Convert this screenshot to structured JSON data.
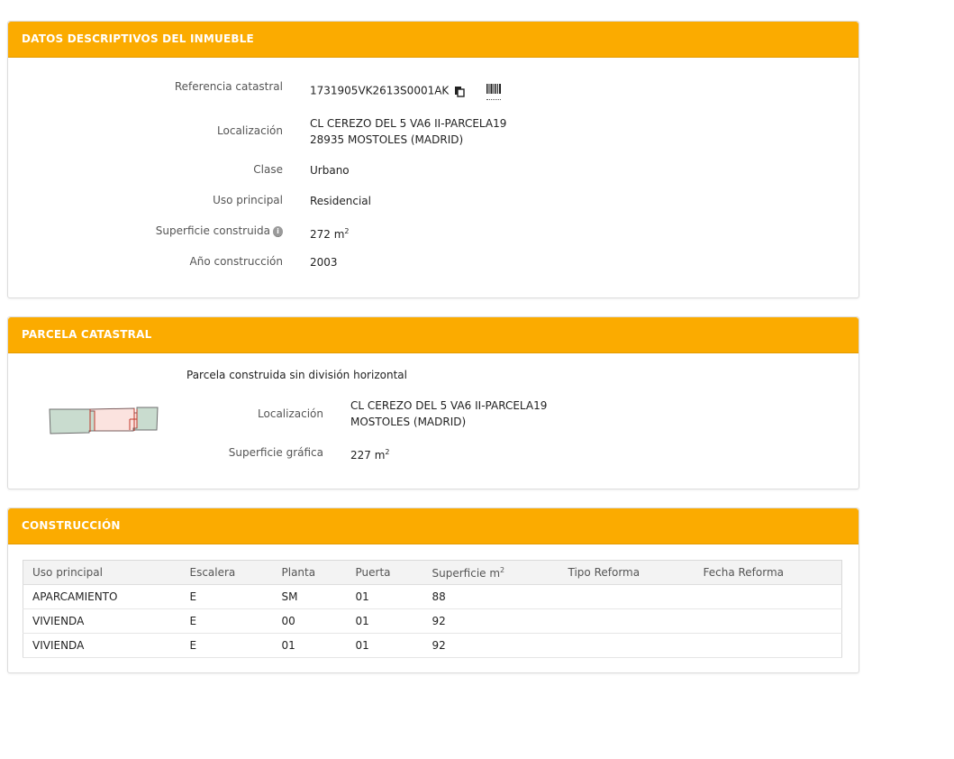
{
  "descriptivos": {
    "title": "DATOS DESCRIPTIVOS DEL INMUEBLE",
    "referencia_label": "Referencia catastral",
    "referencia_value": "1731905VK2613S0001AK",
    "localizacion_label": "Localización",
    "localizacion_line1": "CL CEREZO DEL 5 VA6 II-PARCELA19",
    "localizacion_line2": "28935 MOSTOLES (MADRID)",
    "clase_label": "Clase",
    "clase_value": "Urbano",
    "uso_label": "Uso principal",
    "uso_value": "Residencial",
    "superficie_label": "Superficie construida",
    "superficie_value": "272 m",
    "superficie_unit_exp": "2",
    "anio_label": "Año construcción",
    "anio_value": "2003",
    "icons": [
      "copy-icon",
      "barcode-icon",
      "info-icon"
    ]
  },
  "parcela": {
    "title": "PARCELA CATASTRAL",
    "subtitle": "Parcela construida sin división horizontal",
    "localizacion_label": "Localización",
    "localizacion_line1": "CL CEREZO DEL 5 VA6 II-PARCELA19",
    "localizacion_line2": "MOSTOLES (MADRID)",
    "superficie_label": "Superficie gráfica",
    "superficie_value": "227 m",
    "superficie_unit_exp": "2"
  },
  "construccion": {
    "title": "CONSTRUCCIÓN",
    "columns": [
      "Uso principal",
      "Escalera",
      "Planta",
      "Puerta",
      "Superficie m",
      "Tipo Reforma",
      "Fecha Reforma"
    ],
    "superficie_col_exp": "2",
    "rows": [
      [
        "APARCAMIENTO",
        "E",
        "SM",
        "01",
        "88",
        "",
        ""
      ],
      [
        "VIVIENDA",
        "E",
        "00",
        "01",
        "92",
        "",
        ""
      ],
      [
        "VIVIENDA",
        "E",
        "01",
        "01",
        "92",
        "",
        ""
      ]
    ]
  },
  "colors": {
    "header_bg": "#fbab00",
    "parcel_green": "#c9dccf",
    "parcel_pink": "#fbe3df",
    "parcel_outline_red": "#c0392b"
  }
}
